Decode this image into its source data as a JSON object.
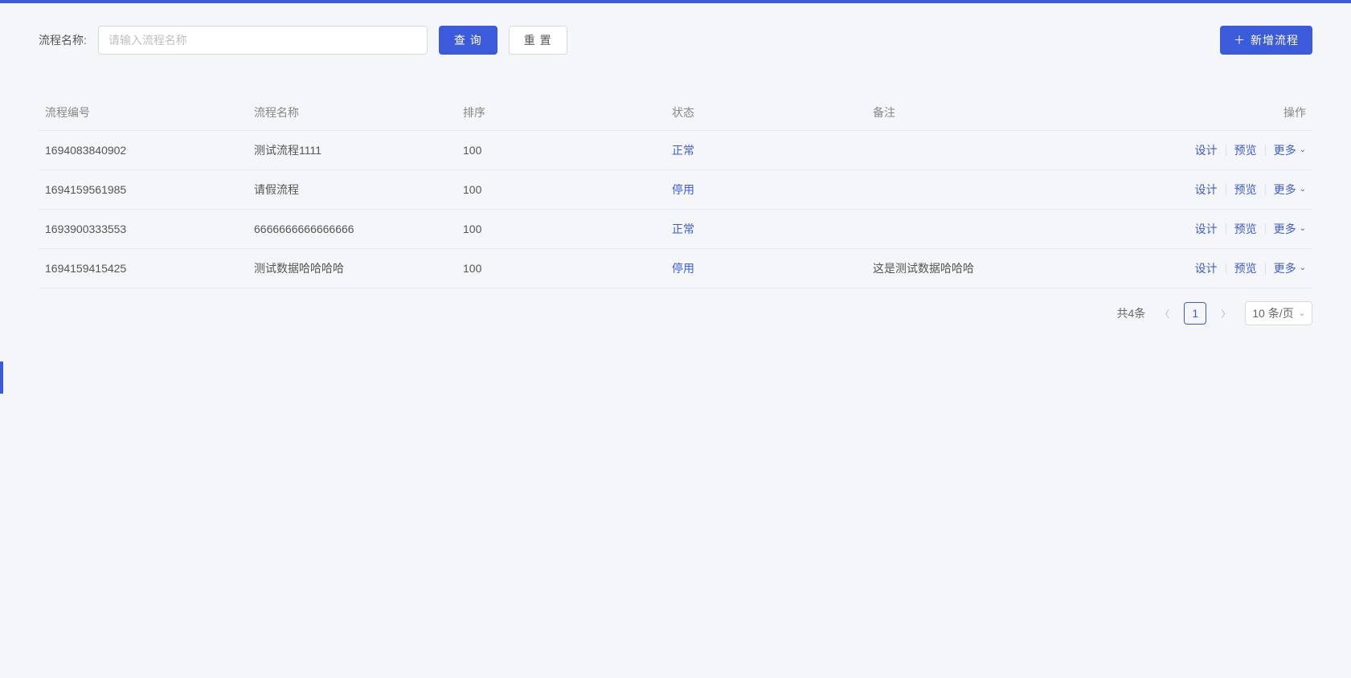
{
  "search": {
    "label": "流程名称:",
    "placeholder": "请输入流程名称",
    "query_btn": "查 询",
    "reset_btn": "重 置",
    "add_btn": "新增流程"
  },
  "table": {
    "headers": {
      "id": "流程编号",
      "name": "流程名称",
      "sort": "排序",
      "status": "状态",
      "remark": "备注",
      "actions": "操作"
    },
    "rows": [
      {
        "id": "1694083840902",
        "name": "测试流程1111",
        "sort": "100",
        "status": "正常",
        "remark": ""
      },
      {
        "id": "1694159561985",
        "name": "请假流程",
        "sort": "100",
        "status": "停用",
        "remark": ""
      },
      {
        "id": "1693900333553",
        "name": "6666666666666666",
        "sort": "100",
        "status": "正常",
        "remark": ""
      },
      {
        "id": "1694159415425",
        "name": "测试数据哈哈哈哈",
        "sort": "100",
        "status": "停用",
        "remark": "这是测试数据哈哈哈"
      }
    ],
    "actions": {
      "design": "设计",
      "preview": "预览",
      "more": "更多"
    }
  },
  "pagination": {
    "total": "共4条",
    "page": "1",
    "page_size": "10 条/页"
  }
}
